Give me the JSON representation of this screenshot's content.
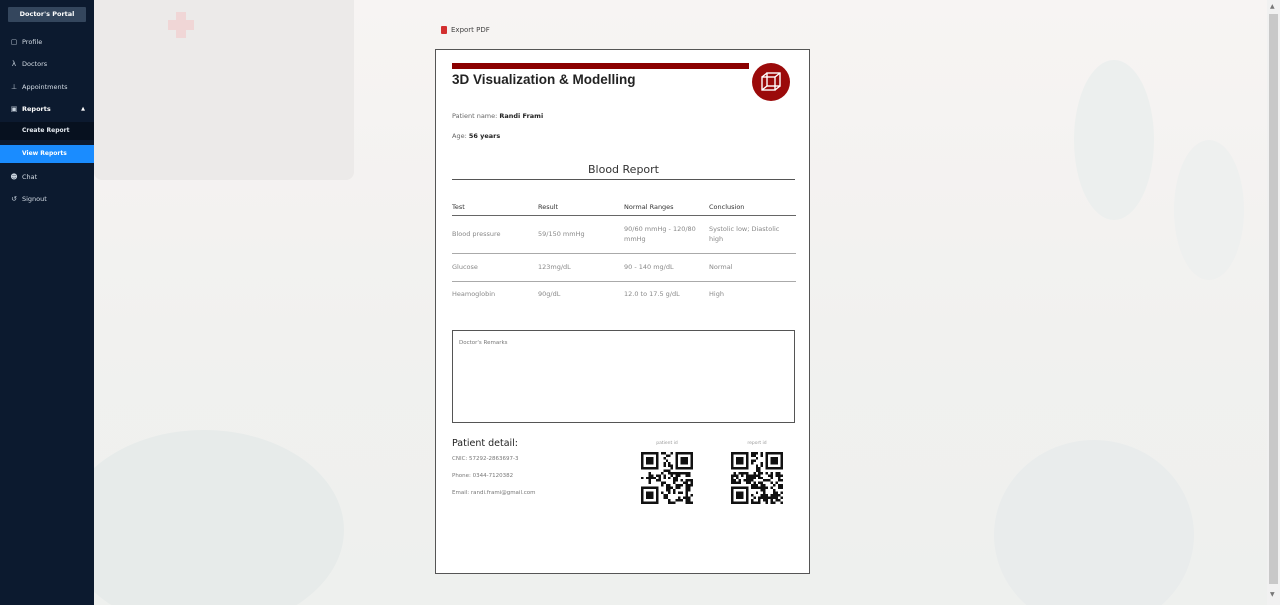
{
  "sidebar": {
    "brand": "Doctor's Portal",
    "items": [
      {
        "label": "Profile",
        "icon": "user-icon"
      },
      {
        "label": "Doctors",
        "icon": "doctor-icon"
      },
      {
        "label": "Appointments",
        "icon": "appointment-icon"
      },
      {
        "label": "Reports",
        "icon": "report-icon"
      },
      {
        "label": "Chat",
        "icon": "chat-icon"
      },
      {
        "label": "Signout",
        "icon": "signout-icon"
      }
    ],
    "sub_items": [
      {
        "label": "Create Report"
      },
      {
        "label": "View Reports"
      }
    ],
    "active_color": "#1a8cff"
  },
  "export": {
    "label": "Export PDF"
  },
  "report": {
    "title": "3D Visualization & Modelling",
    "accent_color": "#8b0000",
    "patient_name_label": "Patient name: ",
    "patient_name": "Randi Frami",
    "age_label": "Age: ",
    "age": "56 years",
    "section_title": "Blood Report",
    "columns": [
      "Test",
      "Result",
      "Normal Ranges",
      "Conclusion"
    ],
    "rows": [
      [
        "Blood pressure",
        "59/150 mmHg",
        "90/60 mmHg - 120/80 mmHg",
        "Systolic low; Diastolic high"
      ],
      [
        "Glucose",
        "123mg/dL",
        "90 - 140 mg/dL",
        "Normal"
      ],
      [
        "Heamoglobin",
        "90g/dL",
        "12.0 to 17.5 g/dL",
        "High"
      ]
    ],
    "remarks_label": "Doctor's Remarks",
    "patient_detail": {
      "title": "Patient detail:",
      "cnic": "CNIC: 57292-2863697-3",
      "phone": "Phone: 0344-7120382",
      "email": "Email: randi.frami@gmail.com"
    },
    "qr_labels": {
      "patient": "patient id",
      "report": "report id"
    }
  }
}
